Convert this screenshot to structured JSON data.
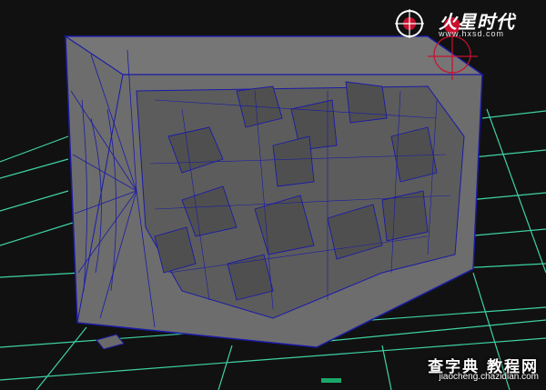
{
  "logo": {
    "text": "火星时代",
    "url": "www.hxsd.com"
  },
  "watermark": {
    "title": "查字典 教程网",
    "url": "jiaocheng.chazidian.com"
  },
  "colors": {
    "background": "#111111",
    "grid": "#3fd2a6",
    "mesh_fill": "#6e6e6e",
    "wireframe": "#1a1aa8",
    "logo_accent": "#c8102e"
  }
}
